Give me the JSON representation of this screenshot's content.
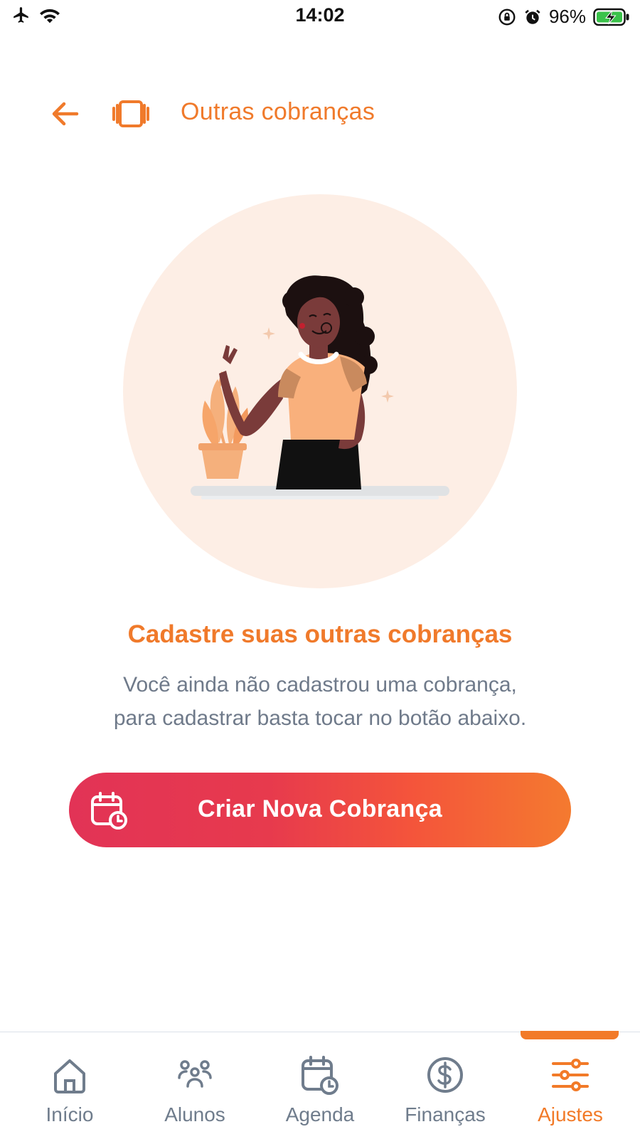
{
  "status_bar": {
    "time": "14:02",
    "battery": "96%",
    "icons": [
      "airplane-icon",
      "wifi-icon",
      "orientation-lock-icon",
      "alarm-icon",
      "battery-icon"
    ]
  },
  "header": {
    "title": "Outras cobranças",
    "back_icon": "arrow-left-icon",
    "section_icon": "cards-icon"
  },
  "empty_state": {
    "headline": "Cadastre suas outras cobranças",
    "description_line1": "Você ainda não cadastrou uma cobrança,",
    "description_line2": "para cadastrar basta tocar no botão abaixo.",
    "illustration": "woman-waving-illustration"
  },
  "cta": {
    "label": "Criar Nova Cobrança",
    "icon": "calendar-clock-icon"
  },
  "tabbar": {
    "items": [
      {
        "label": "Início",
        "icon": "home-icon",
        "active": false
      },
      {
        "label": "Alunos",
        "icon": "people-icon",
        "active": false
      },
      {
        "label": "Agenda",
        "icon": "calendar-clock-icon",
        "active": false
      },
      {
        "label": "Finanças",
        "icon": "dollar-circle-icon",
        "active": false
      },
      {
        "label": "Ajustes",
        "icon": "sliders-icon",
        "active": true
      }
    ]
  },
  "colors": {
    "accent": "#f07a2b",
    "gradient_start": "#e23356",
    "gradient_end": "#f47a2f",
    "muted_text": "#6f7a8a",
    "illustration_bg": "#fdeee5"
  }
}
